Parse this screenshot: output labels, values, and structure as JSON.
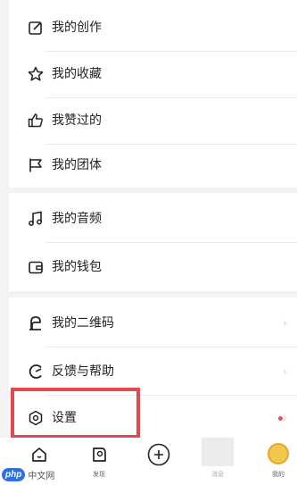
{
  "menu": {
    "group1": [
      {
        "label": "我的创作",
        "icon": "edit-icon"
      },
      {
        "label": "我的收藏",
        "icon": "star-icon"
      },
      {
        "label": "我赞过的",
        "icon": "thumbs-up-icon"
      },
      {
        "label": "我的团体",
        "icon": "flag-icon"
      }
    ],
    "group2": [
      {
        "label": "我的音频",
        "icon": "music-icon"
      },
      {
        "label": "我的钱包",
        "icon": "wallet-icon"
      }
    ],
    "group3": [
      {
        "label": "我的二维码",
        "icon": "qrcode-icon"
      },
      {
        "label": "反馈与帮助",
        "icon": "feedback-icon"
      },
      {
        "label": "设置",
        "icon": "settings-icon"
      }
    ]
  },
  "nav": {
    "home": {
      "label": "",
      "icon": "home-icon"
    },
    "discover": {
      "label": "发现",
      "icon": "discover-icon"
    },
    "create": {
      "label": "",
      "icon": "plus-icon"
    },
    "messages": {
      "label": "消息",
      "icon": "message-icon"
    },
    "me": {
      "label": "我的",
      "icon": "avatar-icon"
    }
  },
  "watermark": {
    "brand": "php",
    "site": "中文网"
  },
  "colors": {
    "highlight": "#e04a4f",
    "dot": "#e8505b",
    "background": "#f3f3f3"
  }
}
